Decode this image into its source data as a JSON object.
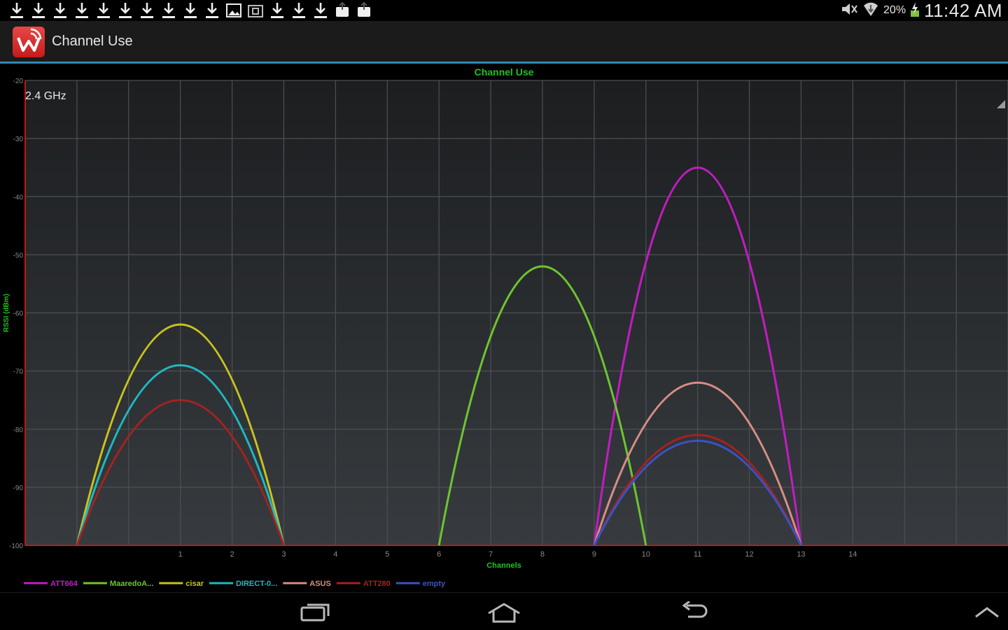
{
  "status_bar": {
    "notification_icons": [
      "download-icon",
      "download-icon",
      "download-icon",
      "download-icon",
      "download-icon",
      "download-icon",
      "download-icon",
      "download-icon",
      "download-icon",
      "download-icon",
      "image-icon",
      "screenshot-icon",
      "download-icon",
      "download-icon",
      "download-icon",
      "photo-upload-icon",
      "photo-upload-icon"
    ],
    "battery_percent": "20%",
    "time": "11:42 AM"
  },
  "action_bar": {
    "title": "Channel Use",
    "accent_color": "#2f88b3"
  },
  "band_selector": {
    "value": "2.4 GHz"
  },
  "chart_data": {
    "type": "line",
    "title": "Channel Use",
    "xlabel": "Channels",
    "ylabel": "RSSI (dBm)",
    "xlim": [
      -2,
      17
    ],
    "ylim": [
      -100,
      -20
    ],
    "x_ticks": [
      1,
      2,
      3,
      4,
      5,
      6,
      7,
      8,
      9,
      10,
      11,
      12,
      13,
      14
    ],
    "y_ticks": [
      -20,
      -30,
      -40,
      -50,
      -60,
      -70,
      -80,
      -90,
      -100
    ],
    "grid": true,
    "legend_position": "bottom-left",
    "series": [
      {
        "name": "ATT664",
        "color": "#c21cc4",
        "channel": 11,
        "peak": -35
      },
      {
        "name": "MaaredoA...",
        "color": "#6ec431",
        "channel": 8,
        "peak": -52
      },
      {
        "name": "cisar",
        "color": "#c9c31d",
        "channel": 1,
        "peak": -62
      },
      {
        "name": "DIRECT-0...",
        "color": "#1fb9c2",
        "channel": 1,
        "peak": -69
      },
      {
        "name": "ASUS",
        "color": "#d78e84",
        "channel": 11,
        "peak": -72
      },
      {
        "name": "ATT280",
        "color": "#a3231f",
        "channel": 1,
        "peak": -75
      },
      {
        "name": "ATT280",
        "color": "#a3231f",
        "channel": 11,
        "peak": -81,
        "in_legend": false
      },
      {
        "name": "empty",
        "color": "#3b52c4",
        "channel": 11,
        "peak": -82
      }
    ]
  },
  "nav_bar": {
    "buttons": [
      "recent-apps-icon",
      "home-icon",
      "back-icon",
      "chevron-up-icon"
    ]
  }
}
